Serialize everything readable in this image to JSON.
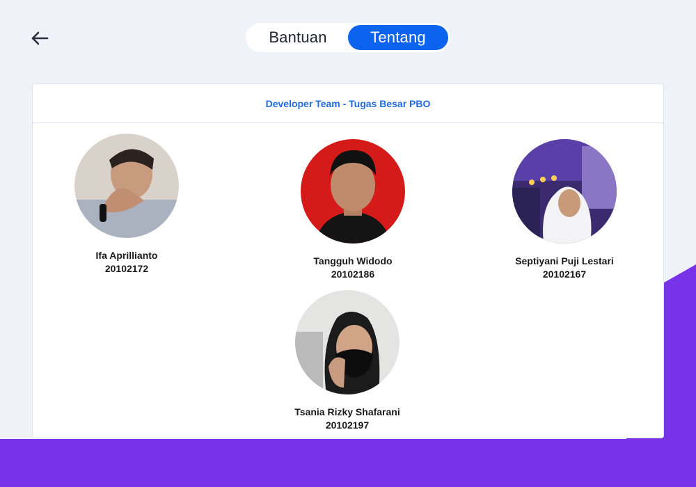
{
  "nav": {
    "back": "back-arrow-icon"
  },
  "tabs": [
    {
      "label": "Bantuan",
      "active": false
    },
    {
      "label": "Tentang",
      "active": true
    }
  ],
  "card": {
    "title": "Developer Team - Tugas Besar PBO",
    "members": [
      {
        "name": "Ifa Aprillianto",
        "id": "20102172"
      },
      {
        "name": "Tangguh Widodo",
        "id": "20102186"
      },
      {
        "name": "Septiyani Puji Lestari",
        "id": "20102167"
      },
      {
        "name": "Tsania Rizky Shafarani",
        "id": "20102197"
      }
    ]
  },
  "colors": {
    "accent": "#0b63ee",
    "purple": "#7832e8",
    "background": "#eff3f9"
  }
}
